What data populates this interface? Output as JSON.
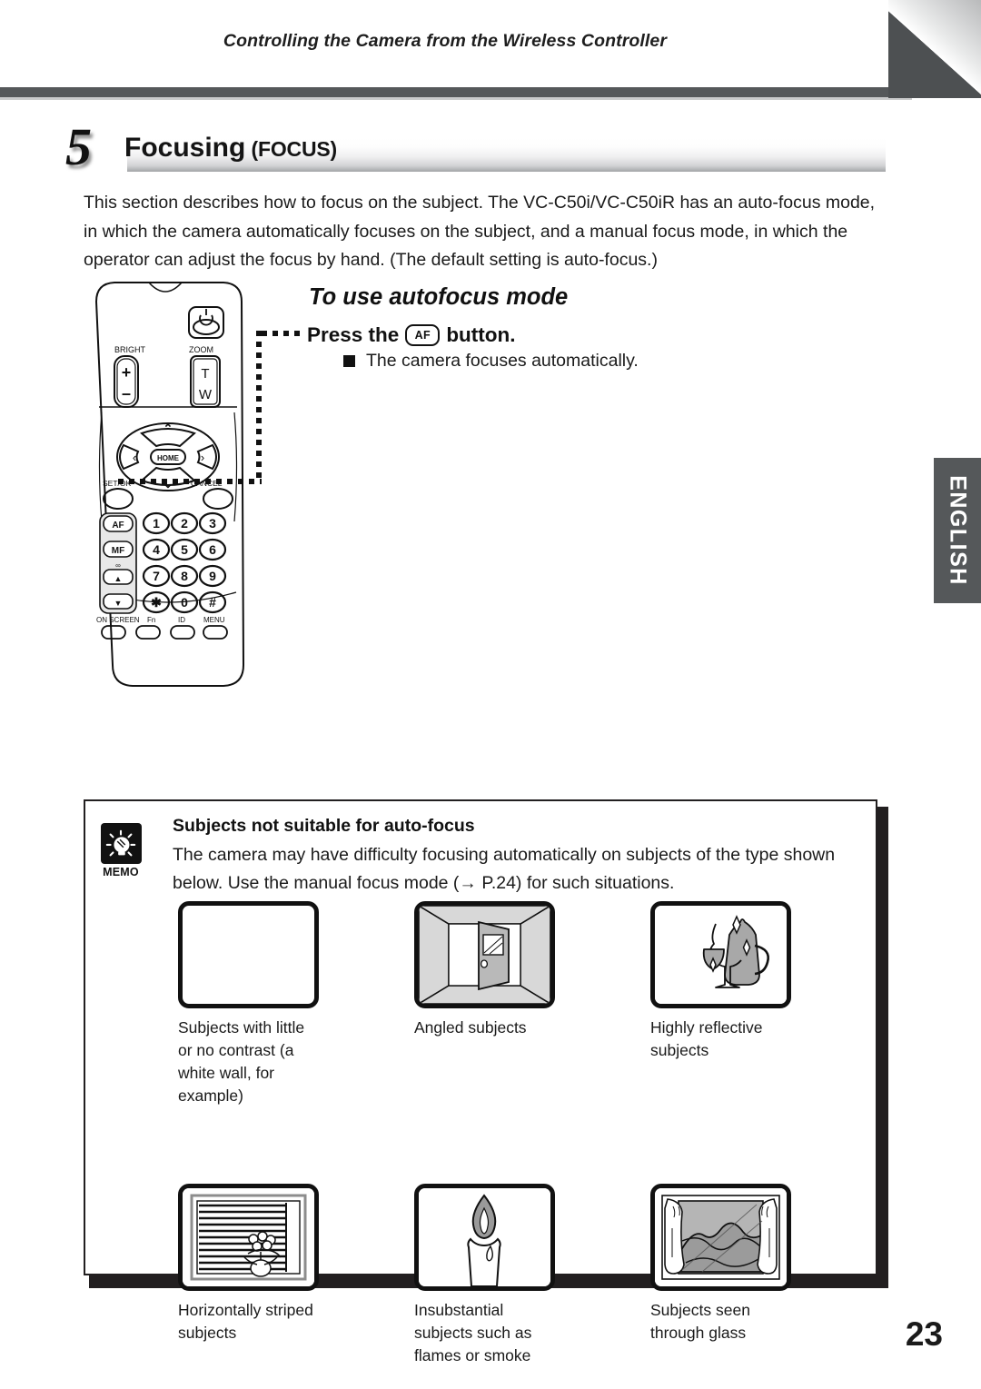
{
  "header": {
    "running_head": "Controlling the Camera from the Wireless Controller"
  },
  "section": {
    "number": "5",
    "title": "Focusing",
    "title_paren": " (FOCUS)"
  },
  "intro": "This section describes how to focus on the subject. The VC-C50i/VC-C50iR has an auto-focus mode, in which the camera automatically focuses on the subject, and a manual focus mode, in which the operator can adjust the focus by hand. (The default setting is auto-focus.)",
  "subsection": {
    "heading": "To use autofocus mode",
    "step_prefix": "Press the",
    "step_chip": "AF",
    "step_suffix": "button.",
    "bullet": "The camera focuses automatically."
  },
  "side_tab": {
    "label": "ENGLISH",
    "color": "#55585a"
  },
  "remote": {
    "power_icon": "power-icon",
    "bright_label": "BRIGHT",
    "bright_plus": "+",
    "bright_minus": "–",
    "zoom_label": "ZOOM",
    "zoom_tele": "T",
    "zoom_wide": "W",
    "home": "HOME",
    "set_ok": "SET/OK",
    "cancel": "CANCEL",
    "af": "AF",
    "mf": "MF",
    "infinity": "∞",
    "focus_near": "▲",
    "focus_far": "▼",
    "keys": [
      "1",
      "2",
      "3",
      "4",
      "5",
      "6",
      "7",
      "8",
      "9",
      "✱",
      "0",
      "#"
    ],
    "bottom_labels": [
      "ON SCREEN",
      "Fn",
      "ID",
      "MENU"
    ]
  },
  "memo": {
    "icon_label": "MEMO",
    "heading": "Subjects not suitable for auto-focus",
    "body": "The camera may have difficulty focusing automatically on subjects of the type shown below. Use the manual focus mode (→ P.24) for such situations.",
    "examples": [
      {
        "caption": "Subjects with little or no contrast (a white wall, for example)",
        "figure": "blank-white-wall"
      },
      {
        "caption": "Angled subjects",
        "figure": "open-door-angled"
      },
      {
        "caption": "Highly reflective subjects",
        "figure": "glass-and-pitcher"
      },
      {
        "caption": "Horizontally striped subjects",
        "figure": "striped-blinds"
      },
      {
        "caption": "Insubstantial subjects such as flames or smoke",
        "figure": "candle-flame"
      },
      {
        "caption": "Subjects seen through glass",
        "figure": "window-landscape"
      }
    ]
  },
  "footer": {
    "page_number": "23"
  }
}
